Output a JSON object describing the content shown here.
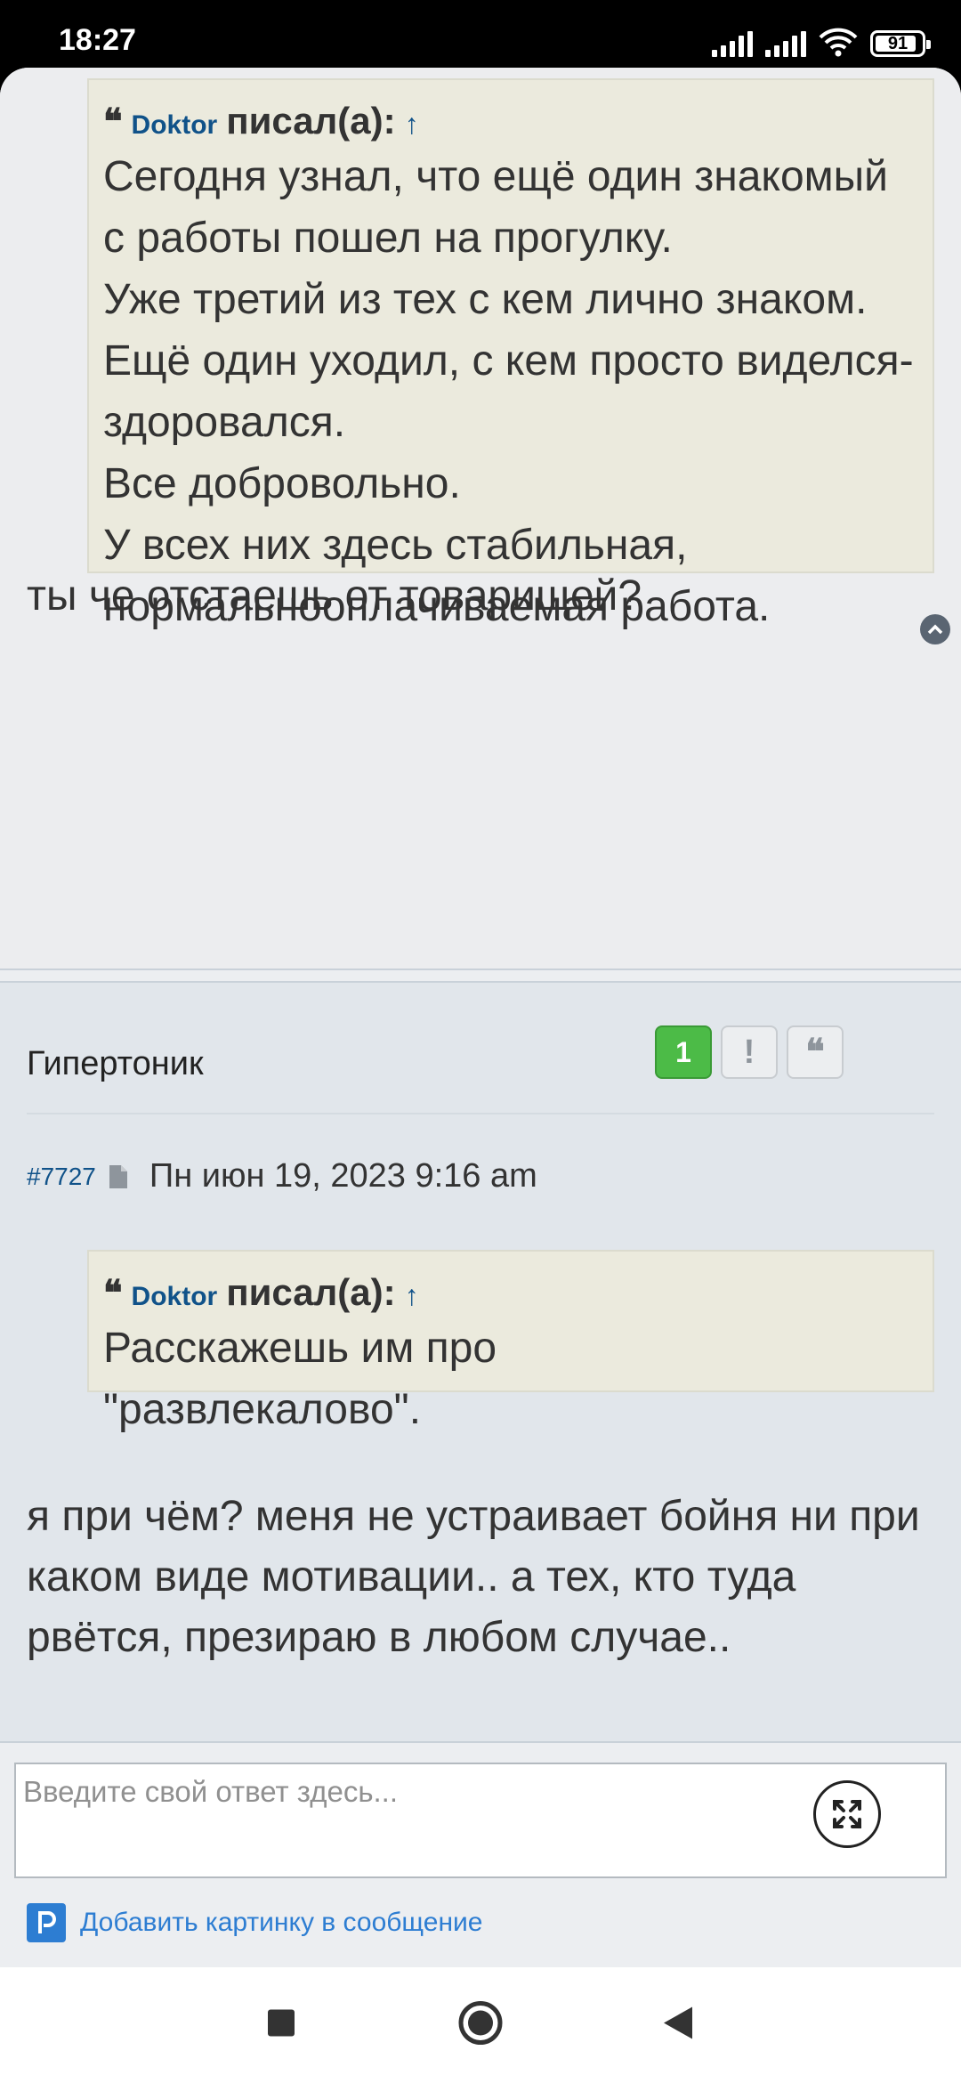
{
  "status_bar": {
    "time": "18:27",
    "battery": "91",
    "icons": [
      "signal-icon",
      "signal-icon",
      "wifi-icon",
      "battery-icon"
    ]
  },
  "post1": {
    "quote": {
      "author": "Doktor",
      "wrote": "писал(а):",
      "arrow": "↑",
      "lines": [
        "Сегодня узнал, что ещё один знакомый с работы пошел на прогулку.",
        "Уже третий из тех с кем лично знаком.",
        "Ещё один уходил, с кем просто виделся-здоровался.",
        "Все добровольно.",
        "У всех них здесь стабильная, нормальнооплачиваемая работа."
      ]
    },
    "text": "ты че отстаешь от товарищей?"
  },
  "post2": {
    "username": "Гипертоник",
    "reaction_count": "1",
    "report_label": "!",
    "post_number": "#7727",
    "date": "Пн июн 19, 2023 9:16 am",
    "quote": {
      "author": "Doktor",
      "wrote": "писал(а):",
      "arrow": "↑",
      "lines": [
        "Расскажешь им про \"развлекалово\"."
      ]
    },
    "text": "я при чём? меня не устраивает бойня ни при каком виде мотивации.. а тех, кто туда рвётся, презираю в любом случае.."
  },
  "reply": {
    "placeholder": "Введите свой ответ здесь...",
    "add_image_label": "Добавить картинку в сообщение"
  },
  "colors": {
    "link": "#105289",
    "quote_bg": "#ebeadd",
    "green": "#4cbb47",
    "accent_blue": "#2d7dd2"
  }
}
